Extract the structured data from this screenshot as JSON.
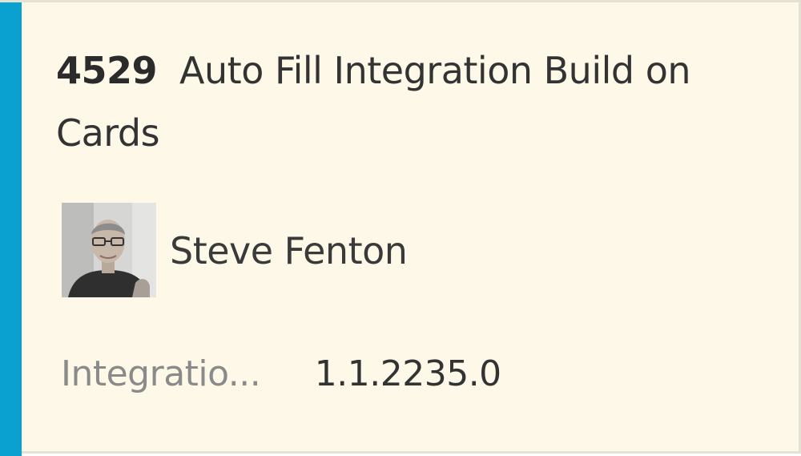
{
  "card": {
    "id": "4529",
    "title": "Auto Fill Integration Build on Cards",
    "assignee": {
      "name": "Steve Fenton",
      "avatar_icon": "user-photo-icon"
    },
    "fields": [
      {
        "label": "Integratio...",
        "value": "1.1.2235.0"
      }
    ]
  },
  "colors": {
    "accent": "#0aa0cf",
    "card_background": "#fdf8e8",
    "label_gray": "#8a8a8a",
    "text": "#333333"
  }
}
